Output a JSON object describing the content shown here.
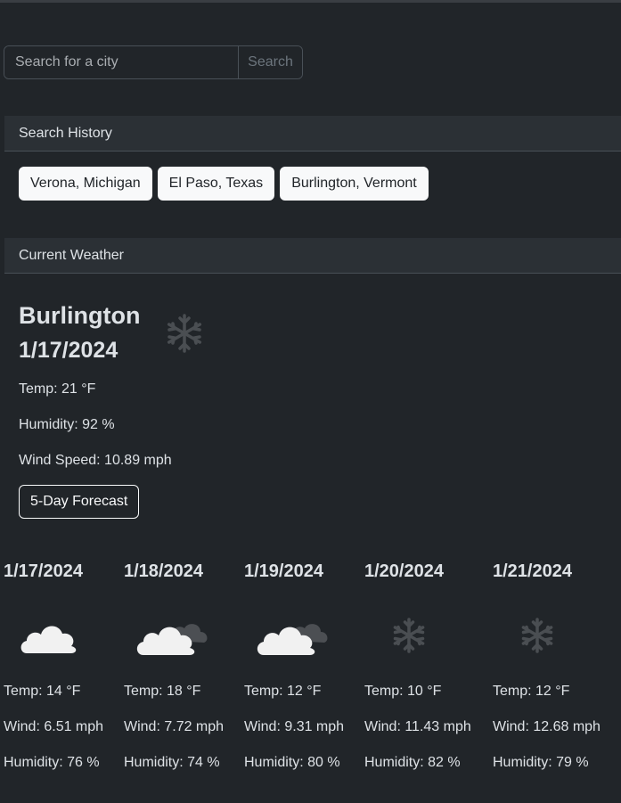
{
  "search": {
    "placeholder": "Search for a city",
    "button_label": "Search"
  },
  "history": {
    "header": "Search History",
    "items": [
      "Verona, Michigan",
      "El Paso, Texas",
      "Burlington, Vermont"
    ]
  },
  "current": {
    "header": "Current Weather",
    "city": "Burlington",
    "date": "1/17/2024",
    "icon": "snow-icon",
    "temp": "Temp: 21 °F",
    "humidity": "Humidity: 92 %",
    "wind": "Wind Speed: 10.89 mph",
    "forecast_button": "5-Day Forecast"
  },
  "forecast": [
    {
      "date": "1/17/2024",
      "icon": "cloud-icon",
      "temp": "Temp: 14 °F",
      "wind": "Wind: 6.51 mph",
      "humidity": "Humidity: 76 %"
    },
    {
      "date": "1/18/2024",
      "icon": "broken-clouds-icon",
      "temp": "Temp: 18 °F",
      "wind": "Wind: 7.72 mph",
      "humidity": "Humidity: 74 %"
    },
    {
      "date": "1/19/2024",
      "icon": "broken-clouds-icon",
      "temp": "Temp: 12 °F",
      "wind": "Wind: 9.31 mph",
      "humidity": "Humidity: 80 %"
    },
    {
      "date": "1/20/2024",
      "icon": "snow-icon",
      "temp": "Temp: 10 °F",
      "wind": "Wind: 11.43 mph",
      "humidity": "Humidity: 82 %"
    },
    {
      "date": "1/21/2024",
      "icon": "snow-icon",
      "temp": "Temp: 12 °F",
      "wind": "Wind: 12.68 mph",
      "humidity": "Humidity: 79 %"
    }
  ]
}
